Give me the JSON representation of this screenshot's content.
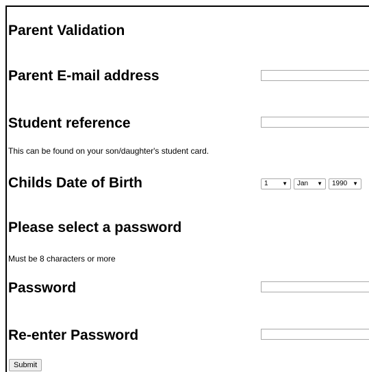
{
  "form": {
    "title": "Parent Validation",
    "email_label": "Parent E-mail address",
    "email_value": "",
    "student_ref_label": "Student reference",
    "student_ref_value": "",
    "student_ref_note": "This can be found on your son/daughter's student card.",
    "dob_label": "Childs Date of Birth",
    "dob_day": "1",
    "dob_month": "Jan",
    "dob_year": "1990",
    "password_section_title": "Please select a password",
    "password_note": "Must be 8 characters or more",
    "password_label": "Password",
    "password_value": "",
    "reenter_label": "Re-enter Password",
    "reenter_value": "",
    "submit_label": "Submit"
  },
  "icons": {
    "select_arrow": "chevron-down-icon"
  }
}
